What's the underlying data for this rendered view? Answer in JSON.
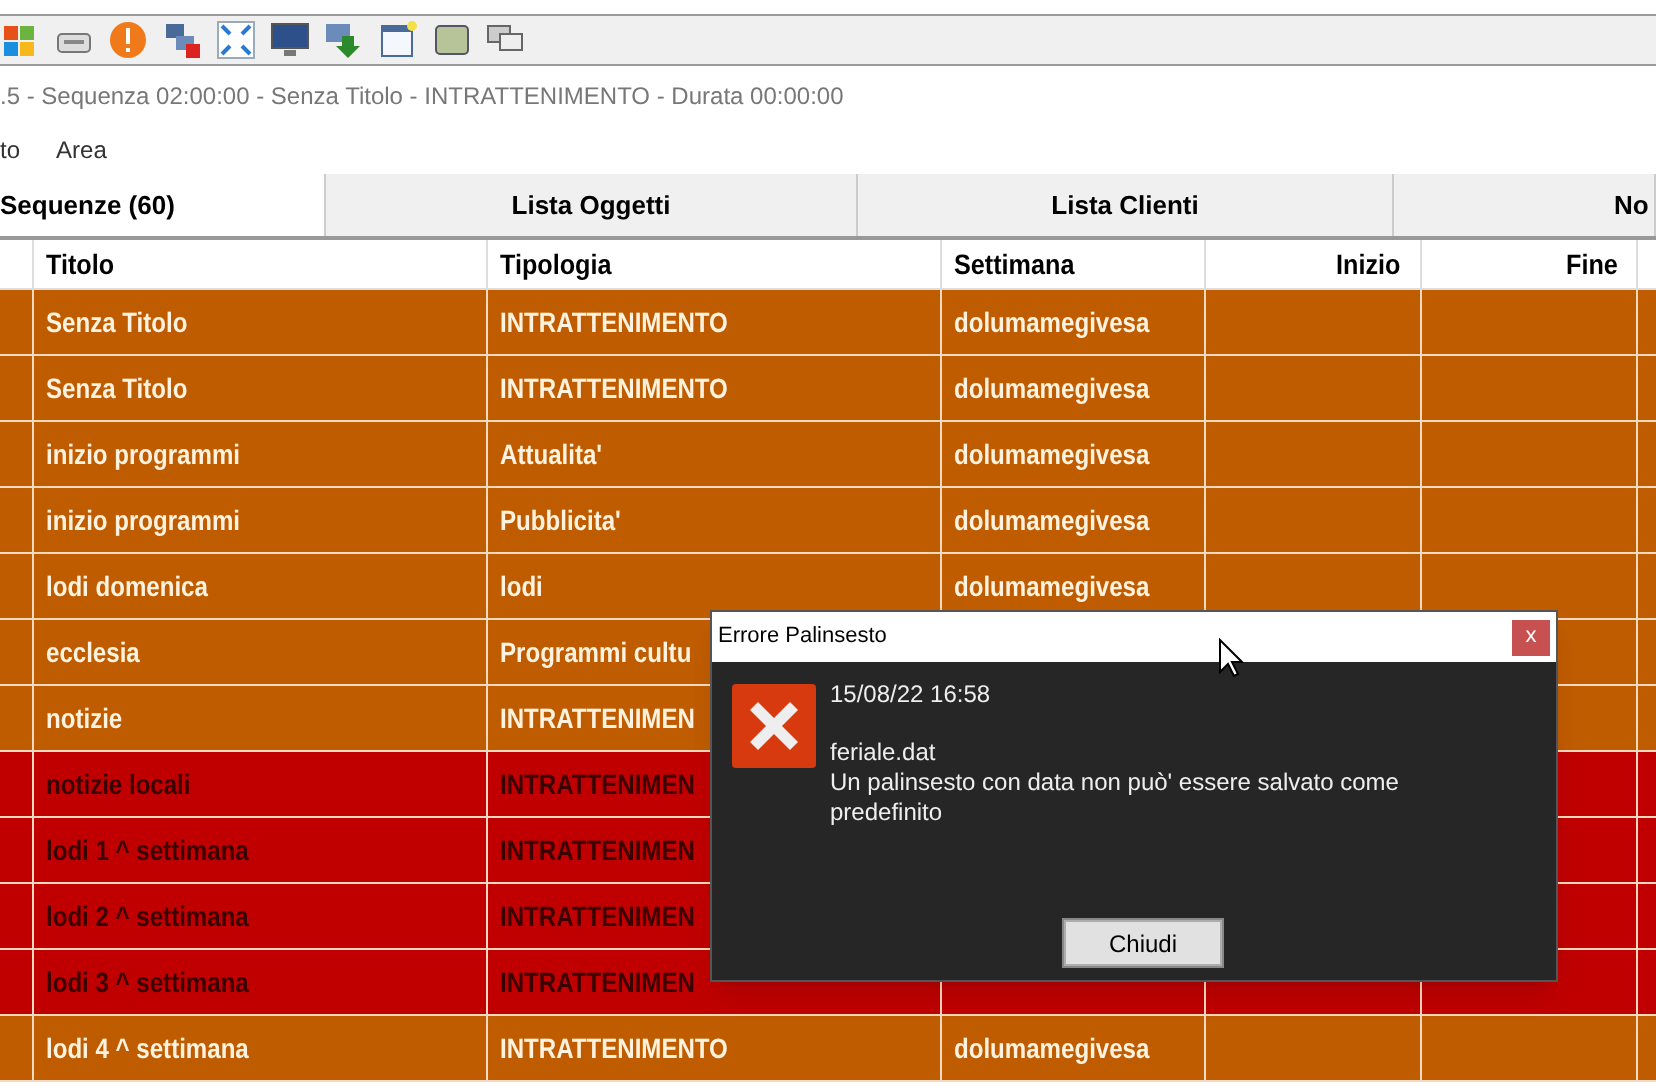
{
  "window": {
    "title": ".5 - Sequenza 02:00:00 - Senza Titolo - INTRATTENIMENTO - Durata 00:00:00"
  },
  "menu": [
    "to",
    "Area"
  ],
  "tabs": [
    {
      "label": "Sequenze (60)",
      "selected": true
    },
    {
      "label": "Lista Oggetti",
      "selected": false
    },
    {
      "label": "Lista Clienti",
      "selected": false
    },
    {
      "label": "No",
      "selected": false
    }
  ],
  "table": {
    "columns": [
      "Titolo",
      "Tipologia",
      "Settimana",
      "Inizio",
      "Fine"
    ],
    "rows": [
      {
        "kind": "normal",
        "titolo": "Senza Titolo",
        "tipologia": "INTRATTENIMENTO",
        "settimana": "dolumamegivesa"
      },
      {
        "kind": "normal",
        "titolo": "Senza Titolo",
        "tipologia": "INTRATTENIMENTO",
        "settimana": "dolumamegivesa"
      },
      {
        "kind": "normal",
        "titolo": "inizio programmi",
        "tipologia": "Attualita'",
        "settimana": "dolumamegivesa"
      },
      {
        "kind": "normal",
        "titolo": "inizio programmi",
        "tipologia": "Pubblicita'",
        "settimana": "dolumamegivesa"
      },
      {
        "kind": "normal",
        "titolo": "lodi domenica",
        "tipologia": "lodi",
        "settimana": "dolumamegivesa"
      },
      {
        "kind": "normal",
        "titolo": "ecclesia",
        "tipologia": "Programmi cultu"
      },
      {
        "kind": "normal",
        "titolo": "notizie",
        "tipologia": "INTRATTENIMEN"
      },
      {
        "kind": "alert",
        "titolo": "notizie locali",
        "tipologia": "INTRATTENIMEN"
      },
      {
        "kind": "alert",
        "titolo": "lodi 1 ^ settimana",
        "tipologia": "INTRATTENIMEN"
      },
      {
        "kind": "alert",
        "titolo": "lodi 2 ^ settimana",
        "tipologia": "INTRATTENIMEN"
      },
      {
        "kind": "alert",
        "titolo": "lodi 3 ^ settimana",
        "tipologia": "INTRATTENIMEN"
      },
      {
        "kind": "normal",
        "titolo": "lodi 4 ^ settimana",
        "tipologia": "INTRATTENIMENTO",
        "settimana": "dolumamegivesa"
      }
    ]
  },
  "dialog": {
    "title": "Errore Palinsesto",
    "close": "x",
    "timestamp": "15/08/22 16:58",
    "file": "feriale.dat",
    "message": "Un palinsesto con data non può' essere salvato come predefinito",
    "button": "Chiudi"
  }
}
